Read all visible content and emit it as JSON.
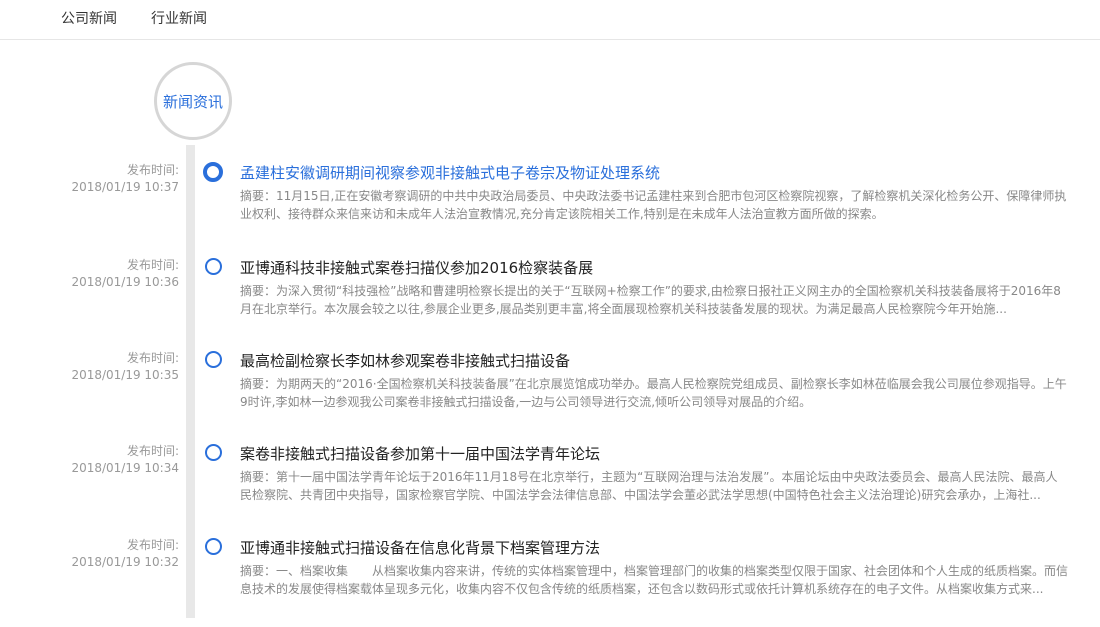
{
  "nav": {
    "tabs": [
      {
        "label": "公司新闻"
      },
      {
        "label": "行业新闻"
      }
    ]
  },
  "header": {
    "title": "新闻资讯"
  },
  "news": [
    {
      "date_label": "发布时间:",
      "date": "2018/01/19 10:37",
      "title": "孟建柱安徽调研期间视察参观非接触式电子卷宗及物证处理系统",
      "summary": "摘要：11月15日,正在安徽考察调研的中共中央政治局委员、中央政法委书记孟建柱来到合肥市包河区检察院视察，了解检察机关深化检务公开、保障律师执业权利、接待群众来信来访和未成年人法治宣教情况,充分肯定该院相关工作,特别是在未成年人法治宣教方面所做的探索。"
    },
    {
      "date_label": "发布时间:",
      "date": "2018/01/19 10:36",
      "title": "亚博通科技非接触式案卷扫描仪参加2016检察装备展",
      "summary": "摘要：为深入贯彻“科技强检”战略和曹建明检察长提出的关于“互联网+检察工作”的要求,由检察日报社正义网主办的全国检察机关科技装备展将于2016年8月在北京举行。本次展会较之以往,参展企业更多,展品类别更丰富,将全面展现检察机关科技装备发展的现状。为满足最高人民检察院今年开始施..."
    },
    {
      "date_label": "发布时间:",
      "date": "2018/01/19 10:35",
      "title": "最高检副检察长李如林参观案卷非接触式扫描设备",
      "summary": "摘要：为期两天的“2016·全国检察机关科技装备展”在北京展览馆成功举办。最高人民检察院党组成员、副检察长李如林莅临展会我公司展位参观指导。上午9时许,李如林一边参观我公司案卷非接触式扫描设备,一边与公司领导进行交流,倾听公司领导对展品的介绍。"
    },
    {
      "date_label": "发布时间:",
      "date": "2018/01/19 10:34",
      "title": "案卷非接触式扫描设备参加第十一届中国法学青年论坛",
      "summary": "摘要：第十一届中国法学青年论坛于2016年11月18号在北京举行，主题为“互联网治理与法治发展”。本届论坛由中央政法委员会、最高人民法院、最高人民检察院、共青团中央指导，国家检察官学院、中国法学会法律信息部、中国法学会董必武法学思想(中国特色社会主义法治理论)研究会承办，上海社..."
    },
    {
      "date_label": "发布时间:",
      "date": "2018/01/19 10:32",
      "title": "亚博通非接触式扫描设备在信息化背景下档案管理方法",
      "summary": "摘要：一、档案收集　　从档案收集内容来讲，传统的实体档案管理中，档案管理部门的收集的档案类型仅限于国家、社会团体和个人生成的纸质档案。而信息技术的发展使得档案载体呈现多元化，收集内容不仅包含传统的纸质档案，还包含以数码形式或依托计算机系统存在的电子文件。从档案收集方式来..."
    }
  ],
  "colors": {
    "accent": "#2a6fdb",
    "rail": "#e8e8e8",
    "muted": "#999999"
  }
}
